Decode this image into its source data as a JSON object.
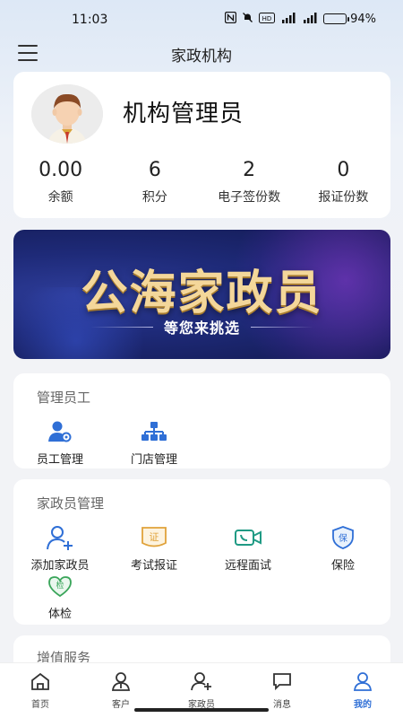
{
  "status_bar": {
    "time": "11:03",
    "battery": "94%",
    "battery_level": 0.94,
    "hd_label": "HD"
  },
  "header": {
    "title": "家政机构"
  },
  "profile": {
    "name": "机构管理员",
    "stats": [
      {
        "value": "0.00",
        "label": "余额"
      },
      {
        "value": "6",
        "label": "积分"
      },
      {
        "value": "2",
        "label": "电子签份数"
      },
      {
        "value": "0",
        "label": "报证份数"
      }
    ]
  },
  "banner": {
    "title": "公海家政员",
    "subtitle": "等您来挑选"
  },
  "staff_section": {
    "title": "管理员工",
    "items": [
      {
        "label": "员工管理",
        "icon": "staff-gear-icon"
      },
      {
        "label": "门店管理",
        "icon": "org-chart-icon"
      }
    ]
  },
  "housekeeper_section": {
    "title": "家政员管理",
    "items": [
      {
        "label": "添加家政员",
        "icon": "add-user-icon"
      },
      {
        "label": "考试报证",
        "icon": "certificate-icon",
        "icon_text": "证"
      },
      {
        "label": "远程面试",
        "icon": "video-call-icon"
      },
      {
        "label": "保险",
        "icon": "insurance-shield-icon",
        "icon_text": "保"
      },
      {
        "label": "体检",
        "icon": "health-check-icon",
        "icon_text": "检"
      }
    ]
  },
  "value_section": {
    "title": "增值服务"
  },
  "bottom_nav": {
    "items": [
      {
        "label": "首页",
        "icon": "home-icon"
      },
      {
        "label": "客户",
        "icon": "customer-icon"
      },
      {
        "label": "家政员",
        "icon": "add-person-icon"
      },
      {
        "label": "消息",
        "icon": "message-icon"
      },
      {
        "label": "我的",
        "icon": "profile-icon",
        "active": true
      }
    ]
  },
  "colors": {
    "accent": "#2f6fd6",
    "icon_blue": "#2f6fd6",
    "icon_orange": "#e0a23a",
    "icon_teal": "#1f9a84",
    "icon_green": "#3aa55a"
  }
}
